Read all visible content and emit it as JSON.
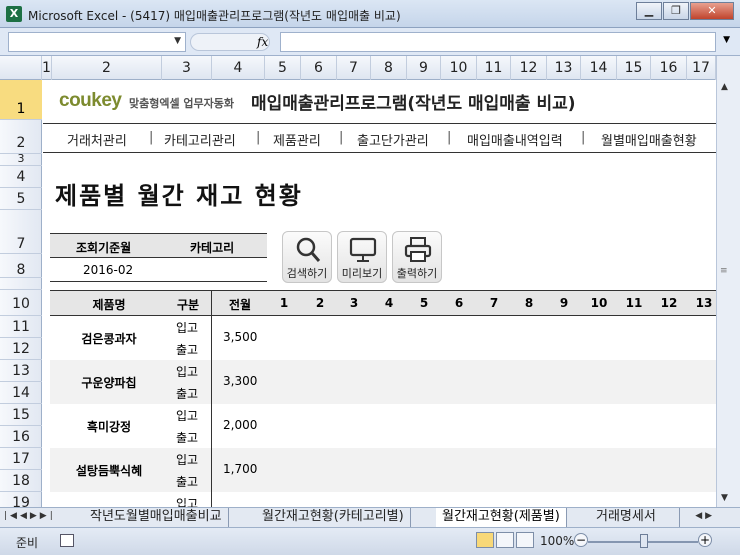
{
  "window": {
    "title": "Microsoft Excel - (5417) 매입매출관리프로그램(작년도 매입매출 비교)",
    "app_icon": "excel-icon"
  },
  "formula": {
    "name_box": "",
    "fx": "fx",
    "value": ""
  },
  "columns": [
    "1",
    "2",
    "3",
    "4",
    "5",
    "6",
    "7",
    "8",
    "9",
    "10",
    "11",
    "12",
    "13",
    "14",
    "15",
    "16",
    "17"
  ],
  "rows": [
    "1",
    "2",
    "3",
    "4",
    "5",
    "7",
    "8",
    "",
    "10",
    "11",
    "12",
    "13",
    "14",
    "15",
    "16",
    "17",
    "18",
    "19"
  ],
  "header": {
    "brand": "coukey",
    "tagline": "맞춤형엑셀 업무자동화",
    "title": "매입매출관리프로그램(작년도 매입매출 비교)"
  },
  "nav": [
    "거래처관리",
    "카테고리관리",
    "제품관리",
    "출고단가관리",
    "매입매출내역입력",
    "월별매입매출현황"
  ],
  "page_title": "제품별 월간 재고 현황",
  "criteria": {
    "period_label": "조회기준월",
    "category_label": "카테고리",
    "period_value": "2016-02",
    "category_value": ""
  },
  "buttons": {
    "search": "검색하기",
    "preview": "미리보기",
    "print": "출력하기"
  },
  "table": {
    "headers": {
      "product": "제품명",
      "type": "구분",
      "prev": "전월",
      "months": [
        "1",
        "2",
        "3",
        "4",
        "5",
        "6",
        "7",
        "8",
        "9",
        "10",
        "11",
        "12",
        "13"
      ]
    },
    "rows": [
      {
        "name": "검은콩과자",
        "in": "입고",
        "out": "출고",
        "prev": "3,500"
      },
      {
        "name": "구운양파칩",
        "in": "입고",
        "out": "출고",
        "prev": "3,300"
      },
      {
        "name": "흑미강정",
        "in": "입고",
        "out": "출고",
        "prev": "2,000"
      },
      {
        "name": "설탕듬뿍식혜",
        "in": "입고",
        "out": "출고",
        "prev": "1,700"
      },
      {
        "name": "",
        "in": "입고",
        "out": "",
        "prev": ""
      }
    ]
  },
  "tabs": [
    "작년도월별매입매출비교",
    "월간재고현황(카테고리별)",
    "월간재고현황(제품별)",
    "거래명세서"
  ],
  "active_tab": 2,
  "status": {
    "ready": "준비",
    "zoom": "100%"
  }
}
